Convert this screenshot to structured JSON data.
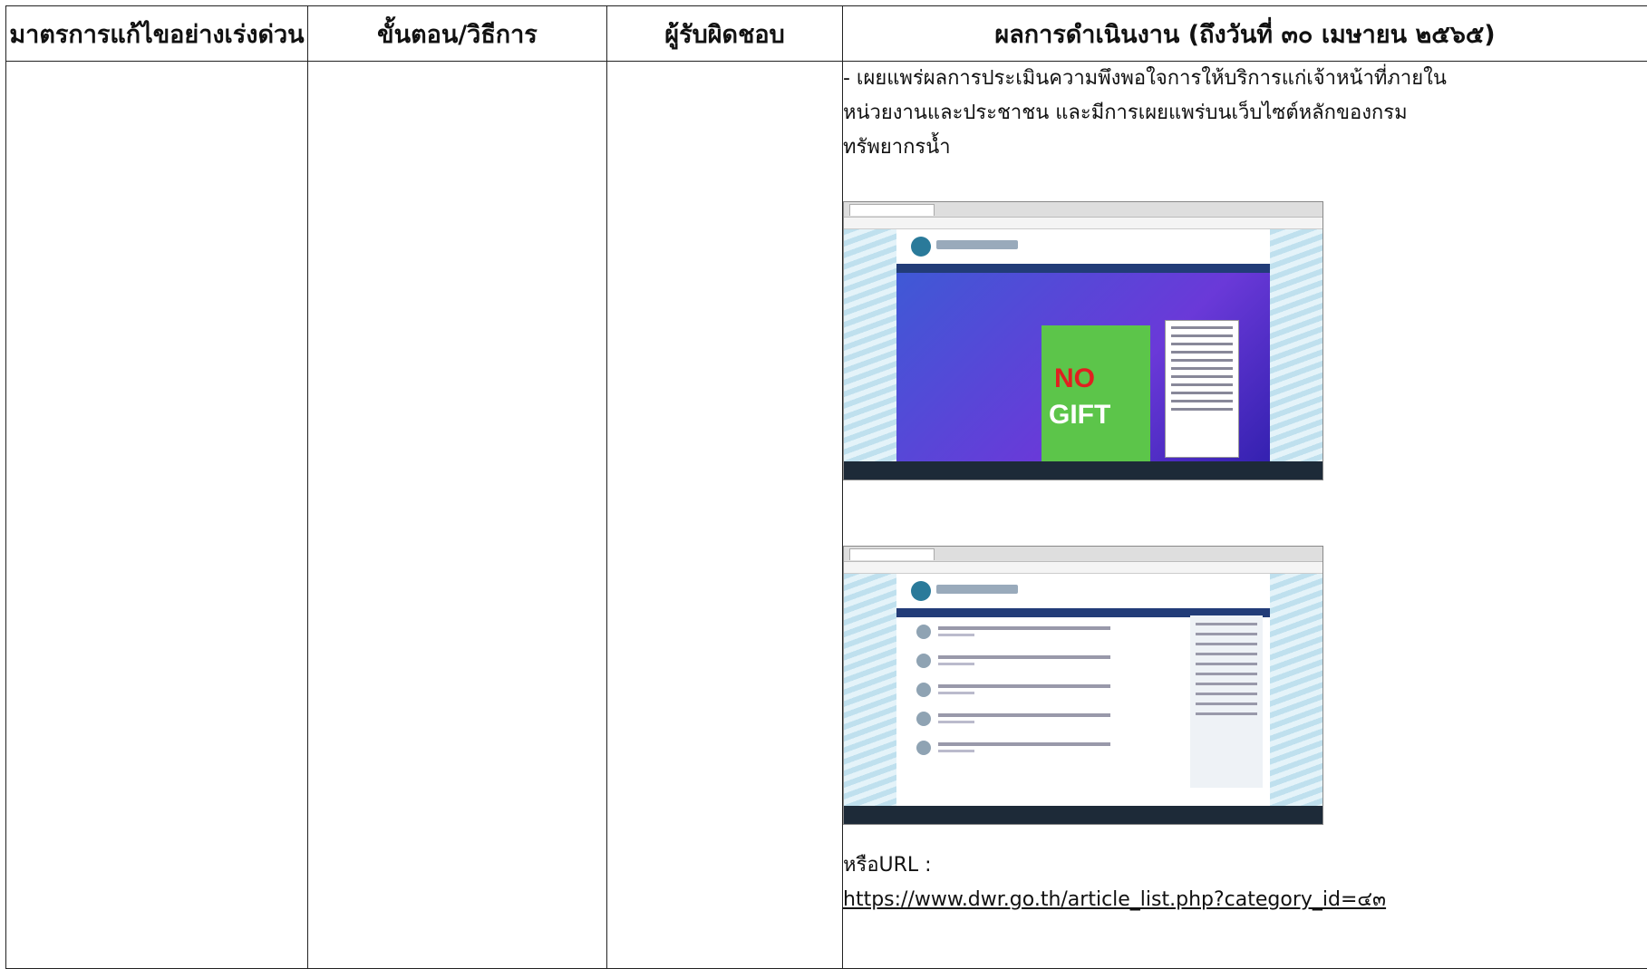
{
  "table": {
    "headers": [
      "มาตรการแก้ไขอย่างเร่งด่วน",
      "ขั้นตอน/วิธีการ",
      "ผู้รับผิดชอบ",
      "ผลการดำเนินงาน (ถึงวันที่ ๓๐ เมษายน ๒๕๖๕)"
    ],
    "result": {
      "line1": "- เผยแพร่ผลการประเมินความพึงพอใจการให้บริการแก่เจ้าหน้าที่ภายใน",
      "line2": "หน่วยงานและประชาชน และมีการเผยแพร่บนเว็บไซต์หลักของกรม",
      "line3": "ทรัพยากรน้ำ",
      "screenshot1": {
        "poster_no": "NO",
        "poster_gift": "GIFT"
      },
      "url_label": "หรือURL :",
      "url": "https://www.dwr.go.th/article_list.php?category_id=๔๓"
    }
  }
}
